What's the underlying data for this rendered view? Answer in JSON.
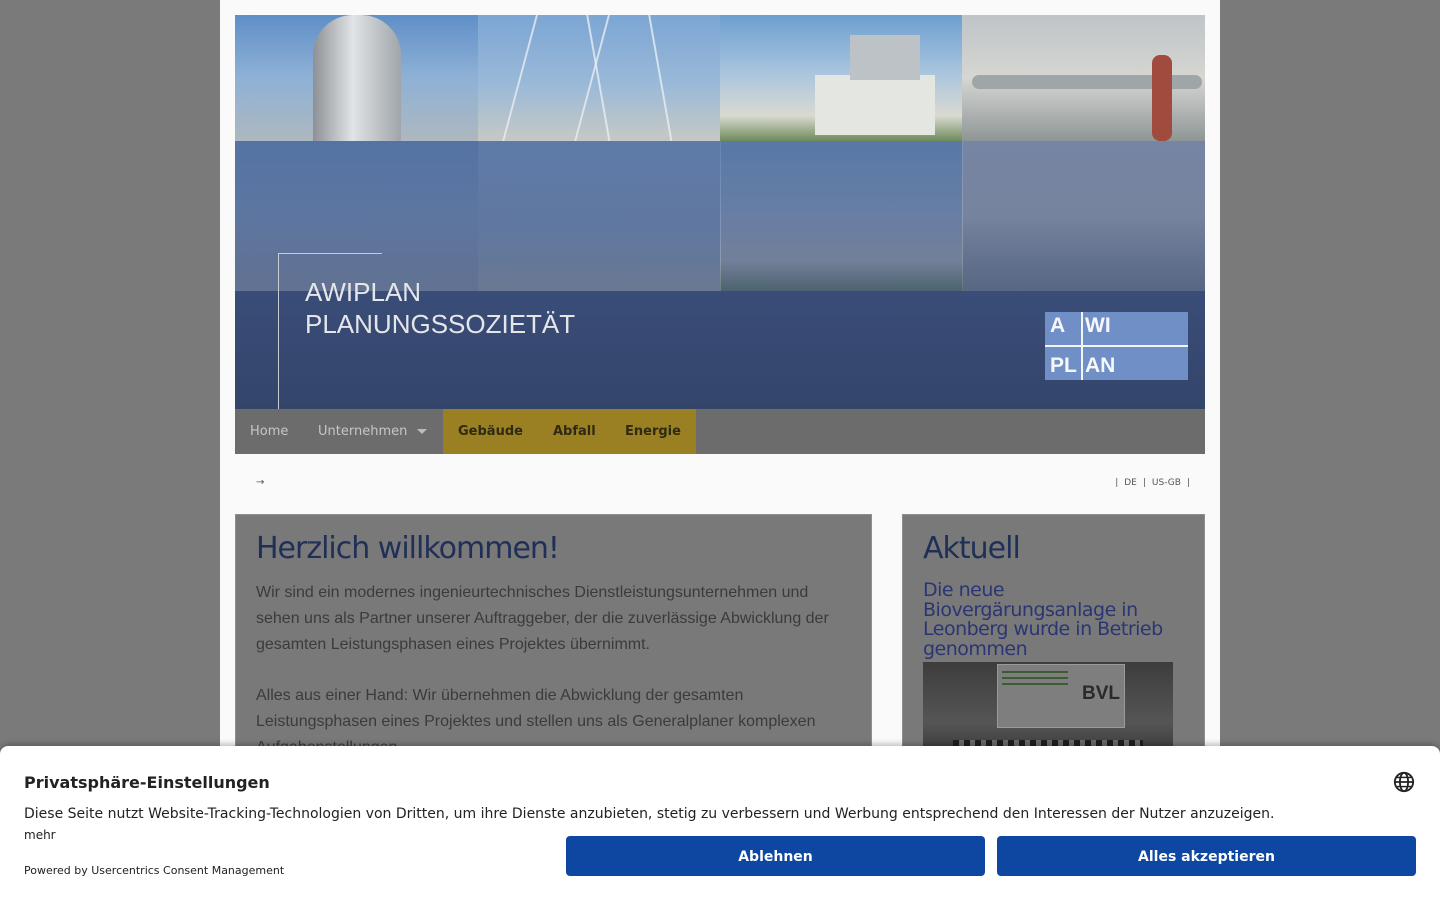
{
  "header": {
    "brand_line1": "AWIPLAN",
    "brand_line2": "PLANUNGSSOZIETÄT",
    "logo": {
      "tl": "A",
      "tr": "WI",
      "bl": "PL",
      "br": "AN"
    }
  },
  "nav": {
    "items": [
      {
        "label": "Home"
      },
      {
        "label": "Unternehmen"
      },
      {
        "label": "Gebäude"
      },
      {
        "label": "Abfall"
      },
      {
        "label": "Energie"
      }
    ]
  },
  "breadcrumb": {
    "arrow": "→"
  },
  "languages": {
    "sep": "|",
    "de": "DE",
    "en": "US-GB"
  },
  "main": {
    "title": "Herzlich willkommen!",
    "paragraph1": "Wir sind ein modernes ingenieurtechnisches Dienstleistungsunternehmen und sehen uns als Partner unserer Auftraggeber, der die zuverlässige Abwicklung der gesamten Leistungsphasen eines Projektes übernimmt.",
    "paragraph2": "Alles aus einer Hand: Wir übernehmen die Abwicklung der gesamten Leistungsphasen eines Projektes und stellen uns als Generalplaner komplexen Aufgabenstellungen."
  },
  "sidebar": {
    "title": "Aktuell",
    "news_title": "Die neue Biovergärungsanlage in Leonberg wurde in Betrieb genommen",
    "image_banner_text": "BVL"
  },
  "consent": {
    "title": "Privatsphäre-Einstellungen",
    "text": "Diese Seite nutzt Website-Tracking-Technologien von Dritten, um ihre Dienste anzubieten, stetig zu verbessern und Werbung entsprechend den Interessen der Nutzer anzuzeigen.",
    "more": "mehr",
    "powered": "Powered by Usercentrics Consent Management",
    "deny_label": "Ablehnen",
    "accept_label": "Alles akzeptieren"
  },
  "colors": {
    "nav_accent": "#9a8023",
    "button_blue": "#0d47a1",
    "heading_blue": "#1f2f57"
  }
}
